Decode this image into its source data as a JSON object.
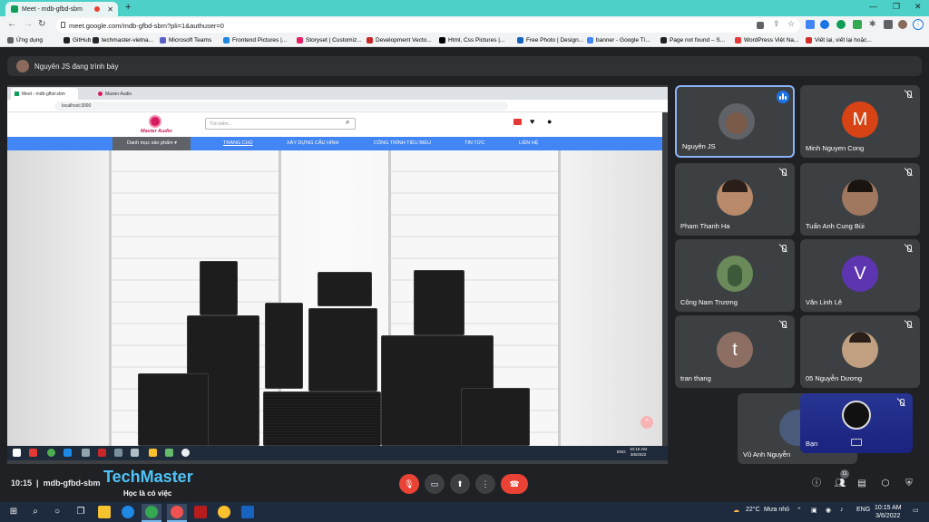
{
  "browser": {
    "tab_title": "Meet - mdb-gfbd-sbm",
    "url": "meet.google.com/mdb-gfbd-sbm?pli=1&authuser=0",
    "bookmarks": [
      {
        "label": "Ứng dụng",
        "color": "#5f6368"
      },
      {
        "label": "GitHub",
        "color": "#202124"
      },
      {
        "label": "techmaster-vietna...",
        "color": "#24292e"
      },
      {
        "label": "Microsoft Teams",
        "color": "#5b5fc7"
      },
      {
        "label": "Frontend Pictures |...",
        "color": "#1e88e5"
      },
      {
        "label": "Storyset | Customiz...",
        "color": "#e91e63"
      },
      {
        "label": "Development Vecto...",
        "color": "#c62828"
      },
      {
        "label": "Html, Css Pictures |...",
        "color": "#000000"
      },
      {
        "label": "Free Photo | Design...",
        "color": "#1565c0"
      },
      {
        "label": "banner - Google Tì...",
        "color": "#4285f4"
      },
      {
        "label": "Page not found – S...",
        "color": "#212121"
      },
      {
        "label": "WordPress Việt Na...",
        "color": "#e53935"
      },
      {
        "label": "Viết lại, viết lại hoặc...",
        "color": "#d32f2f"
      }
    ]
  },
  "meet": {
    "presenter_banner": "Nguyên JS đang trình bày",
    "meeting_time": "10:15",
    "meeting_code": "mdb-gfbd-sbm",
    "watermark_logo": "TechMaster",
    "watermark_sub": "Học là có việc",
    "people_count": "11",
    "participants": [
      {
        "name": "Nguyên JS",
        "type": "photo",
        "color": "#7a5a48",
        "speaking": true
      },
      {
        "name": "Minh Nguyen Cong",
        "type": "letter",
        "letter": "M",
        "color": "#d84315"
      },
      {
        "name": "Pham Thanh Ha",
        "type": "photo",
        "color": "#b88a6a"
      },
      {
        "name": "Tuấn Anh Cung Bùi",
        "type": "photo",
        "color": "#a07860"
      },
      {
        "name": "Công Nam Trương",
        "type": "photo",
        "color": "#6a8a5a"
      },
      {
        "name": "Văn Linh Lê",
        "type": "letter",
        "letter": "V",
        "color": "#5e35b1"
      },
      {
        "name": "tran thang",
        "type": "letter",
        "letter": "t",
        "color": "#8d6e63"
      },
      {
        "name": "05 Nguyễn Dương",
        "type": "photo",
        "color": "#c0a080"
      },
      {
        "name": "Vũ Anh Nguyễn",
        "type": "photo",
        "color": "#4a5a7a"
      },
      {
        "name": "Bạn",
        "type": "self",
        "color": "#1a237e"
      }
    ]
  },
  "shared_screen": {
    "tab1": "Meet - mdb-gfbd-sbm",
    "tab2": "Master Audio",
    "url": "localhost:3000",
    "logo_text": "Master Audio",
    "search_placeholder": "Tìm kiếm...",
    "category_menu": "Danh mục sản phẩm",
    "nav": [
      "TRANG CHỦ",
      "XÂY DỰNG CẤU HÌNH",
      "CÔNG TRÌNH TIÊU BIỂU",
      "TIN TỨC",
      "LIÊN HỆ"
    ],
    "time": "10:15 AM",
    "date": "3/6/2022",
    "lang": "ENG"
  },
  "taskbar": {
    "weather": "22°C",
    "weather_desc": "Mưa nhỏ",
    "lang": "ENG",
    "time": "10:15 AM",
    "date": "3/6/2022"
  }
}
